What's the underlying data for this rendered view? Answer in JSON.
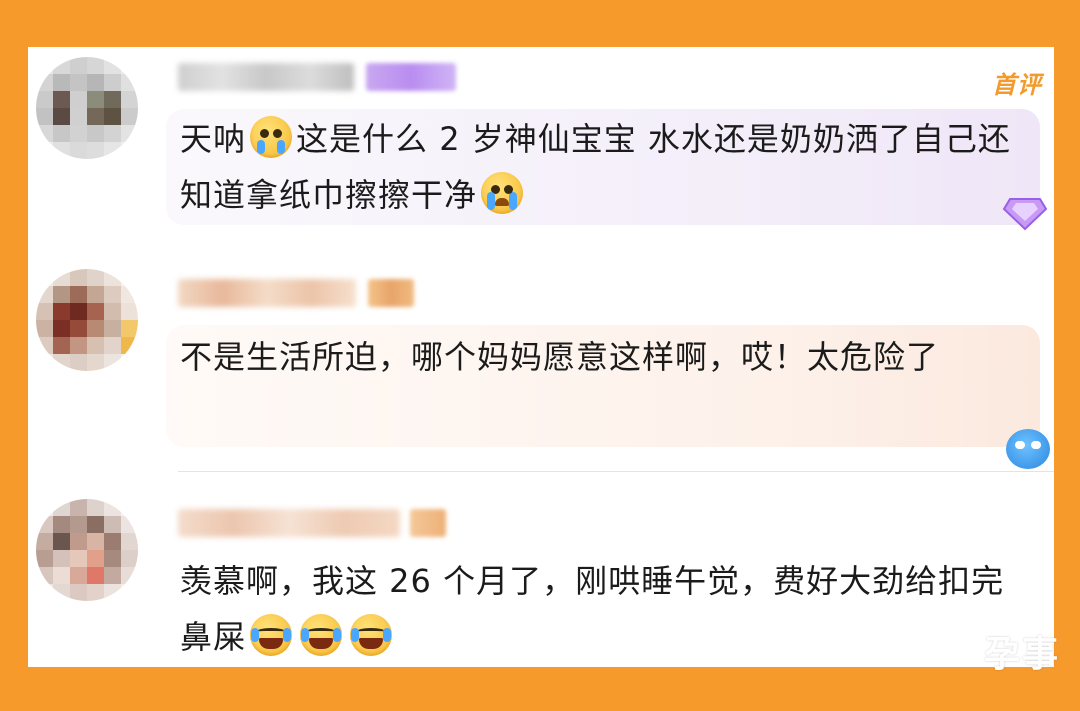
{
  "comments": [
    {
      "text_before": "天呐",
      "text_after": "这是什么 2 岁神仙宝宝  水水还是奶奶洒了自己还知道拿纸巾擦擦干净",
      "tag": "首评"
    },
    {
      "text": "不是生活所迫，哪个妈妈愿意这样啊，哎！太危险了"
    },
    {
      "text": "羡慕啊，我这 26 个月了，刚哄睡午觉，费好大劲给扣完鼻屎"
    }
  ],
  "watermark": "孕事",
  "colors": {
    "frame": "#f79a2c",
    "tag": "#f39a2c",
    "bubble1": "#f4eefa",
    "bubble2": "#fdf2ea"
  }
}
